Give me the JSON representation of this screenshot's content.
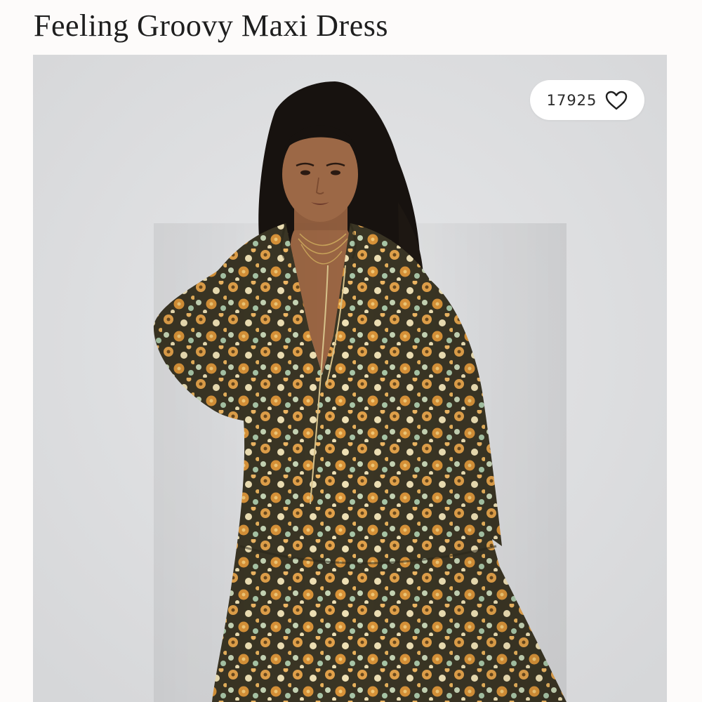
{
  "product": {
    "title": "Feeling Groovy Maxi Dress"
  },
  "image": {
    "subject": "model-wearing-floral-maxi-dress",
    "palette": {
      "background": "#dfe0e2",
      "dress_base": "#3a3524",
      "dress_floral_orange": "#e3a24a",
      "dress_floral_cream": "#efe1b5",
      "dress_floral_mint": "#a9c7a8",
      "skin": "#9c6846",
      "hair": "#17120f"
    }
  },
  "favorites": {
    "count": "17925",
    "icon": "heart-outline-icon"
  }
}
